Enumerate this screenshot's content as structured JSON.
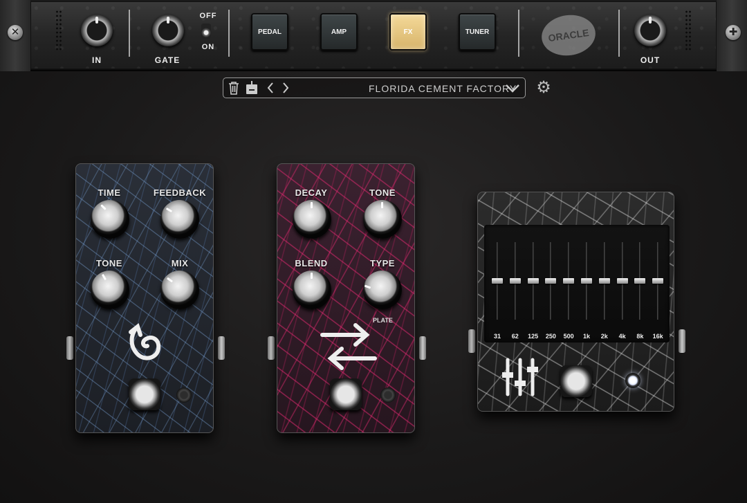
{
  "header": {
    "in_label": "IN",
    "gate_label": "GATE",
    "gate_toggle_off": "OFF",
    "gate_toggle_on": "ON",
    "nav": [
      {
        "label": "PEDAL",
        "active": false
      },
      {
        "label": "AMP",
        "active": false
      },
      {
        "label": "FX",
        "active": true
      },
      {
        "label": "TUNER",
        "active": false
      }
    ],
    "logo_text": "ORACLE",
    "out_label": "OUT"
  },
  "preset": {
    "name": "FLORIDA CEMENT FACTORY",
    "icons": [
      "trash-icon",
      "save-icon",
      "chevron-left-icon",
      "chevron-right-icon",
      "chevron-down-icon",
      "gear-icon"
    ]
  },
  "pedals": {
    "delay": {
      "knobs": [
        {
          "label": "TIME"
        },
        {
          "label": "FEEDBACK"
        },
        {
          "label": "TONE"
        },
        {
          "label": "MIX"
        }
      ],
      "symbol": "delay-swirl-icon",
      "color": "#7fa6d6"
    },
    "reverb": {
      "knobs": [
        {
          "label": "DECAY"
        },
        {
          "label": "TONE"
        },
        {
          "label": "BLEND"
        },
        {
          "label": "TYPE",
          "sublabel": "PLATE"
        }
      ],
      "symbol": "reverb-arrows-icon",
      "color": "#d8286e"
    },
    "eq": {
      "bands": [
        {
          "label": "31",
          "level": 0.5
        },
        {
          "label": "62",
          "level": 0.5
        },
        {
          "label": "125",
          "level": 0.5
        },
        {
          "label": "250",
          "level": 0.5
        },
        {
          "label": "500",
          "level": 0.5
        },
        {
          "label": "1k",
          "level": 0.5
        },
        {
          "label": "2k",
          "level": 0.5
        },
        {
          "label": "4k",
          "level": 0.5
        },
        {
          "label": "8k",
          "level": 0.5
        },
        {
          "label": "16k",
          "level": 0.5
        }
      ],
      "symbol": "eq-sliders-icon",
      "led_on": true
    }
  },
  "colors": {
    "accent_active": "#e8c57d",
    "background": "#1b1a1a"
  }
}
